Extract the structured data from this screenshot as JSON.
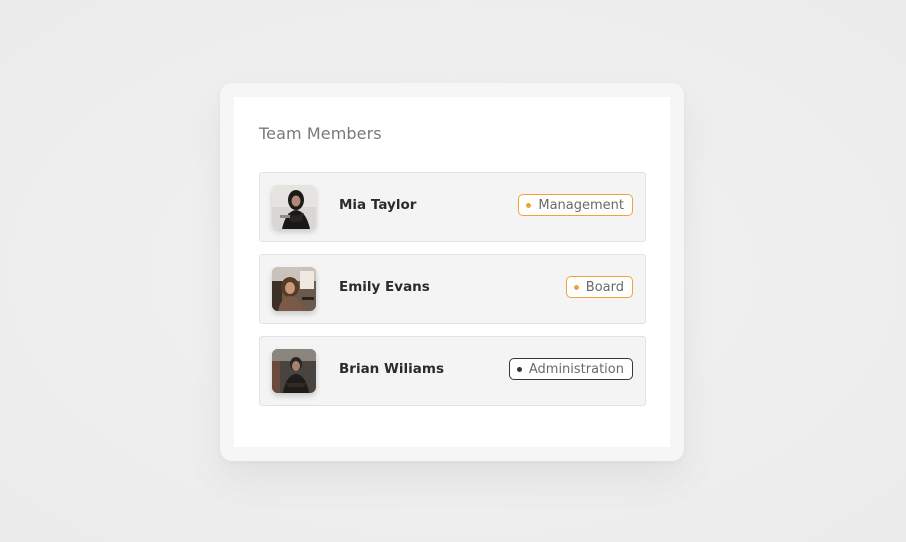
{
  "card": {
    "title": "Team Members"
  },
  "members": [
    {
      "name": "Mia Taylor",
      "role": "Management",
      "role_color": "#f2a23c"
    },
    {
      "name": "Emily Evans",
      "role": "Board",
      "role_color": "#f2a23c"
    },
    {
      "name": "Brian Wiliams",
      "role": "Administration",
      "role_color": "#3a3532"
    }
  ],
  "colors": {
    "accent": "#f2a23c",
    "text_dark": "#2b2b2b",
    "title_muted": "#7d7873"
  }
}
